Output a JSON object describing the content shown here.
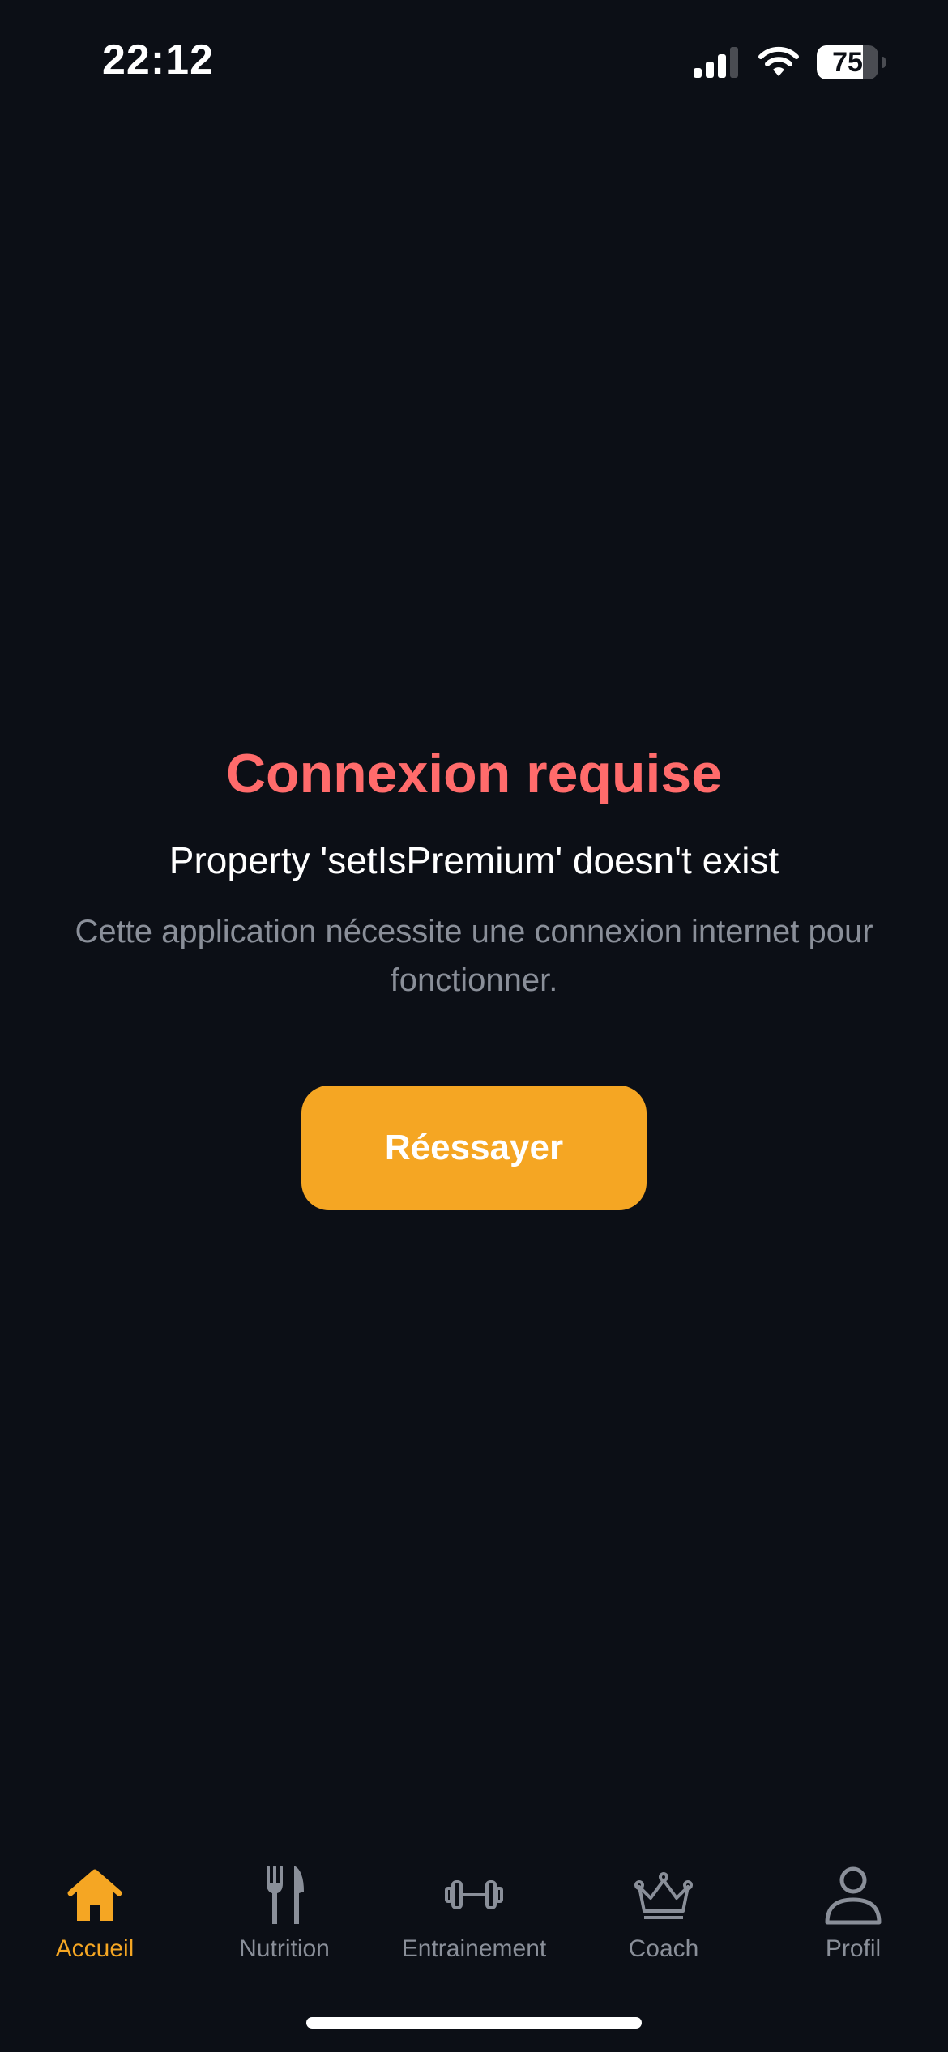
{
  "status_bar": {
    "time": "22:12",
    "battery_level": "75",
    "battery_fraction": 0.75,
    "signal_icon": "cellular-signal-icon",
    "wifi_icon": "wifi-icon"
  },
  "error": {
    "title": "Connexion requise",
    "message": "Property 'setIsPremium' doesn't exist",
    "hint": "Cette application nécessite une connexion internet pour fonctionner.",
    "retry_label": "Réessayer"
  },
  "tab_bar": {
    "items": [
      {
        "label": "Accueil",
        "icon": "home-icon",
        "active": true
      },
      {
        "label": "Nutrition",
        "icon": "fork-knife-icon",
        "active": false
      },
      {
        "label": "Entrainement",
        "icon": "dumbbell-icon",
        "active": false
      },
      {
        "label": "Coach",
        "icon": "crown-icon",
        "active": false
      },
      {
        "label": "Profil",
        "icon": "person-icon",
        "active": false
      }
    ]
  },
  "colors": {
    "background": "#0c0f16",
    "accent": "#f5a623",
    "error": "#ff6b6b",
    "muted": "#8a8f99"
  }
}
